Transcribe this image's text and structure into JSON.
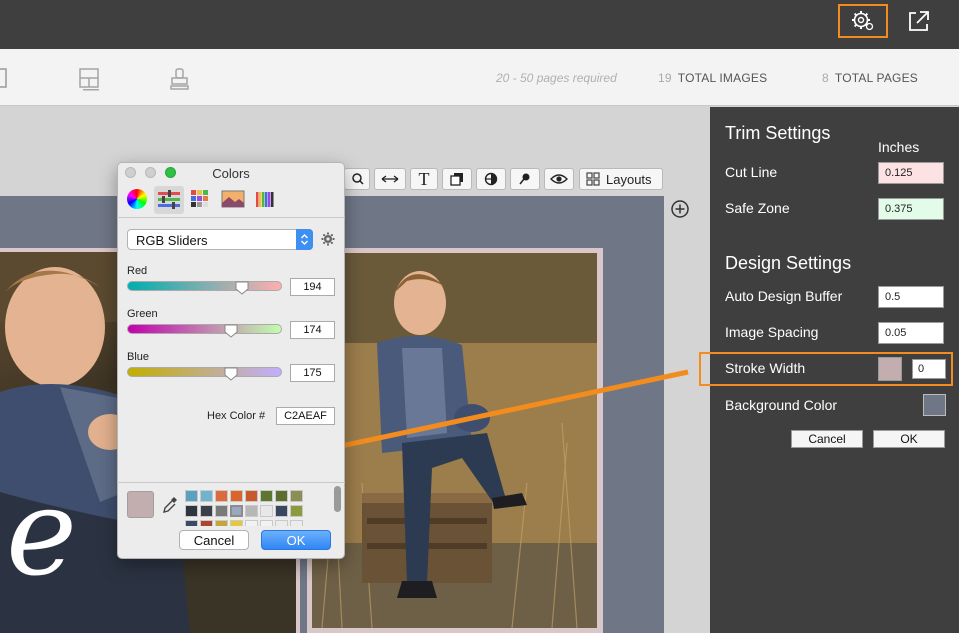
{
  "header": {
    "settings_icon": "gear-settings-icon",
    "export_icon": "external-link-icon",
    "highlight_color": "#f28c1f"
  },
  "toolbar": {
    "pages_required": "20 - 50 pages required",
    "total_images_num": "19",
    "total_images_label": "TOTAL IMAGES",
    "total_pages_num": "8",
    "total_pages_label": "TOTAL PAGES"
  },
  "edit_tools": {
    "layouts_label": "Layouts",
    "text_tool": "T"
  },
  "right_panel": {
    "trim_title": "Trim Settings",
    "units": "Inches",
    "cut_line_label": "Cut Line",
    "cut_line_value": "0.125",
    "safe_zone_label": "Safe Zone",
    "safe_zone_value": "0.375",
    "design_title": "Design Settings",
    "auto_buffer_label": "Auto Design Buffer",
    "auto_buffer_value": "0.5",
    "image_spacing_label": "Image Spacing",
    "image_spacing_value": "0.05",
    "stroke_width_label": "Stroke Width",
    "stroke_width_value": "0",
    "stroke_color": "#c2aeaf",
    "background_color_label": "Background Color",
    "background_color": "#6f7686",
    "cancel_label": "Cancel",
    "ok_label": "OK"
  },
  "colors_dialog": {
    "title": "Colors",
    "mode": "RGB Sliders",
    "red_label": "Red",
    "red_value": "194",
    "green_label": "Green",
    "green_value": "174",
    "blue_label": "Blue",
    "blue_value": "175",
    "hex_label": "Hex Color #",
    "hex_value": "C2AEAF",
    "current_color": "#c2aeaf",
    "cancel_label": "Cancel",
    "ok_label": "OK",
    "swatches_row1": [
      "#5b9fc1",
      "#71b3cf",
      "#dd6a3a",
      "#d9652d",
      "#c9582a",
      "#5f7532",
      "#5b6e2f",
      "#8a8f55"
    ],
    "swatches_row2": [
      "#2e3440",
      "#3b3f48",
      "#7a7a7a",
      "#9aa7c0",
      "#b7b7b7",
      "#e8e8e8",
      "#38475e",
      "#8a9a3c"
    ],
    "swatches_row3": [
      "#3a4a66",
      "#b04230",
      "#c6a536",
      "#e9c73c",
      "#f2f2f2",
      "#f2f2f2",
      "#ececec",
      "#ececec"
    ]
  },
  "canvas": {
    "frame_color": "#d9c7c9",
    "script_text": "e"
  }
}
